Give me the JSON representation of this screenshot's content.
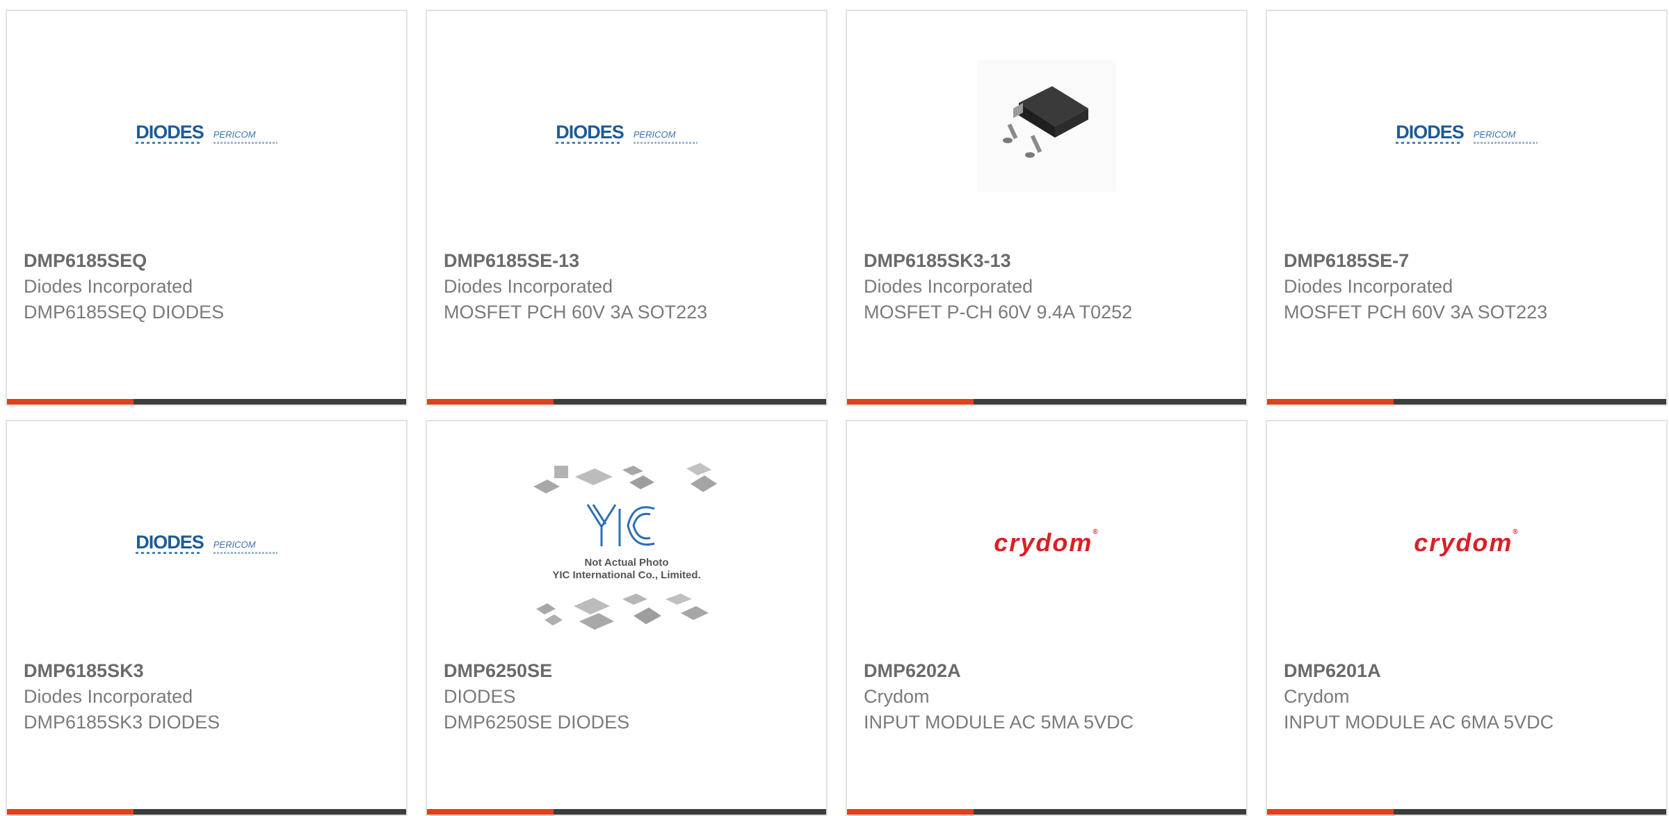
{
  "colors": {
    "accent": "#e0401c",
    "bar": "#3d3d3d",
    "border": "#e2e2e2",
    "diodes_blue": "#1d5b96",
    "crydom_red": "#d92027"
  },
  "products": [
    {
      "part": "DMP6185SEQ",
      "manufacturer": "Diodes Incorporated",
      "description": "DMP6185SEQ DIODES",
      "image": "diodes-logo",
      "logo_text": "DIODES",
      "logo_sub": "PERICOM"
    },
    {
      "part": "DMP6185SE-13",
      "manufacturer": "Diodes Incorporated",
      "description": "MOSFET PCH 60V 3A SOT223",
      "image": "diodes-logo",
      "logo_text": "DIODES",
      "logo_sub": "PERICOM"
    },
    {
      "part": "DMP6185SK3-13",
      "manufacturer": "Diodes Incorporated",
      "description": "MOSFET P-CH 60V 9.4A T0252",
      "image": "to252-package-photo"
    },
    {
      "part": "DMP6185SE-7",
      "manufacturer": "Diodes Incorporated",
      "description": "MOSFET PCH 60V 3A SOT223",
      "image": "diodes-logo",
      "logo_text": "DIODES",
      "logo_sub": "PERICOM"
    },
    {
      "part": "DMP6185SK3",
      "manufacturer": "Diodes Incorporated",
      "description": "DMP6185SK3 DIODES",
      "image": "diodes-logo",
      "logo_text": "DIODES",
      "logo_sub": "PERICOM"
    },
    {
      "part": "DMP6250SE",
      "manufacturer": "DIODES",
      "description": "DMP6250SE DIODES",
      "image": "yic-placeholder",
      "placeholder_line1": "Not Actual Photo",
      "placeholder_line2": "YIC International Co., Limited."
    },
    {
      "part": "DMP6202A",
      "manufacturer": "Crydom",
      "description": "INPUT MODULE AC 5MA 5VDC",
      "image": "crydom-logo",
      "logo_text": "crydom"
    },
    {
      "part": "DMP6201A",
      "manufacturer": "Crydom",
      "description": "INPUT MODULE AC 6MA 5VDC",
      "image": "crydom-logo",
      "logo_text": "crydom"
    }
  ]
}
